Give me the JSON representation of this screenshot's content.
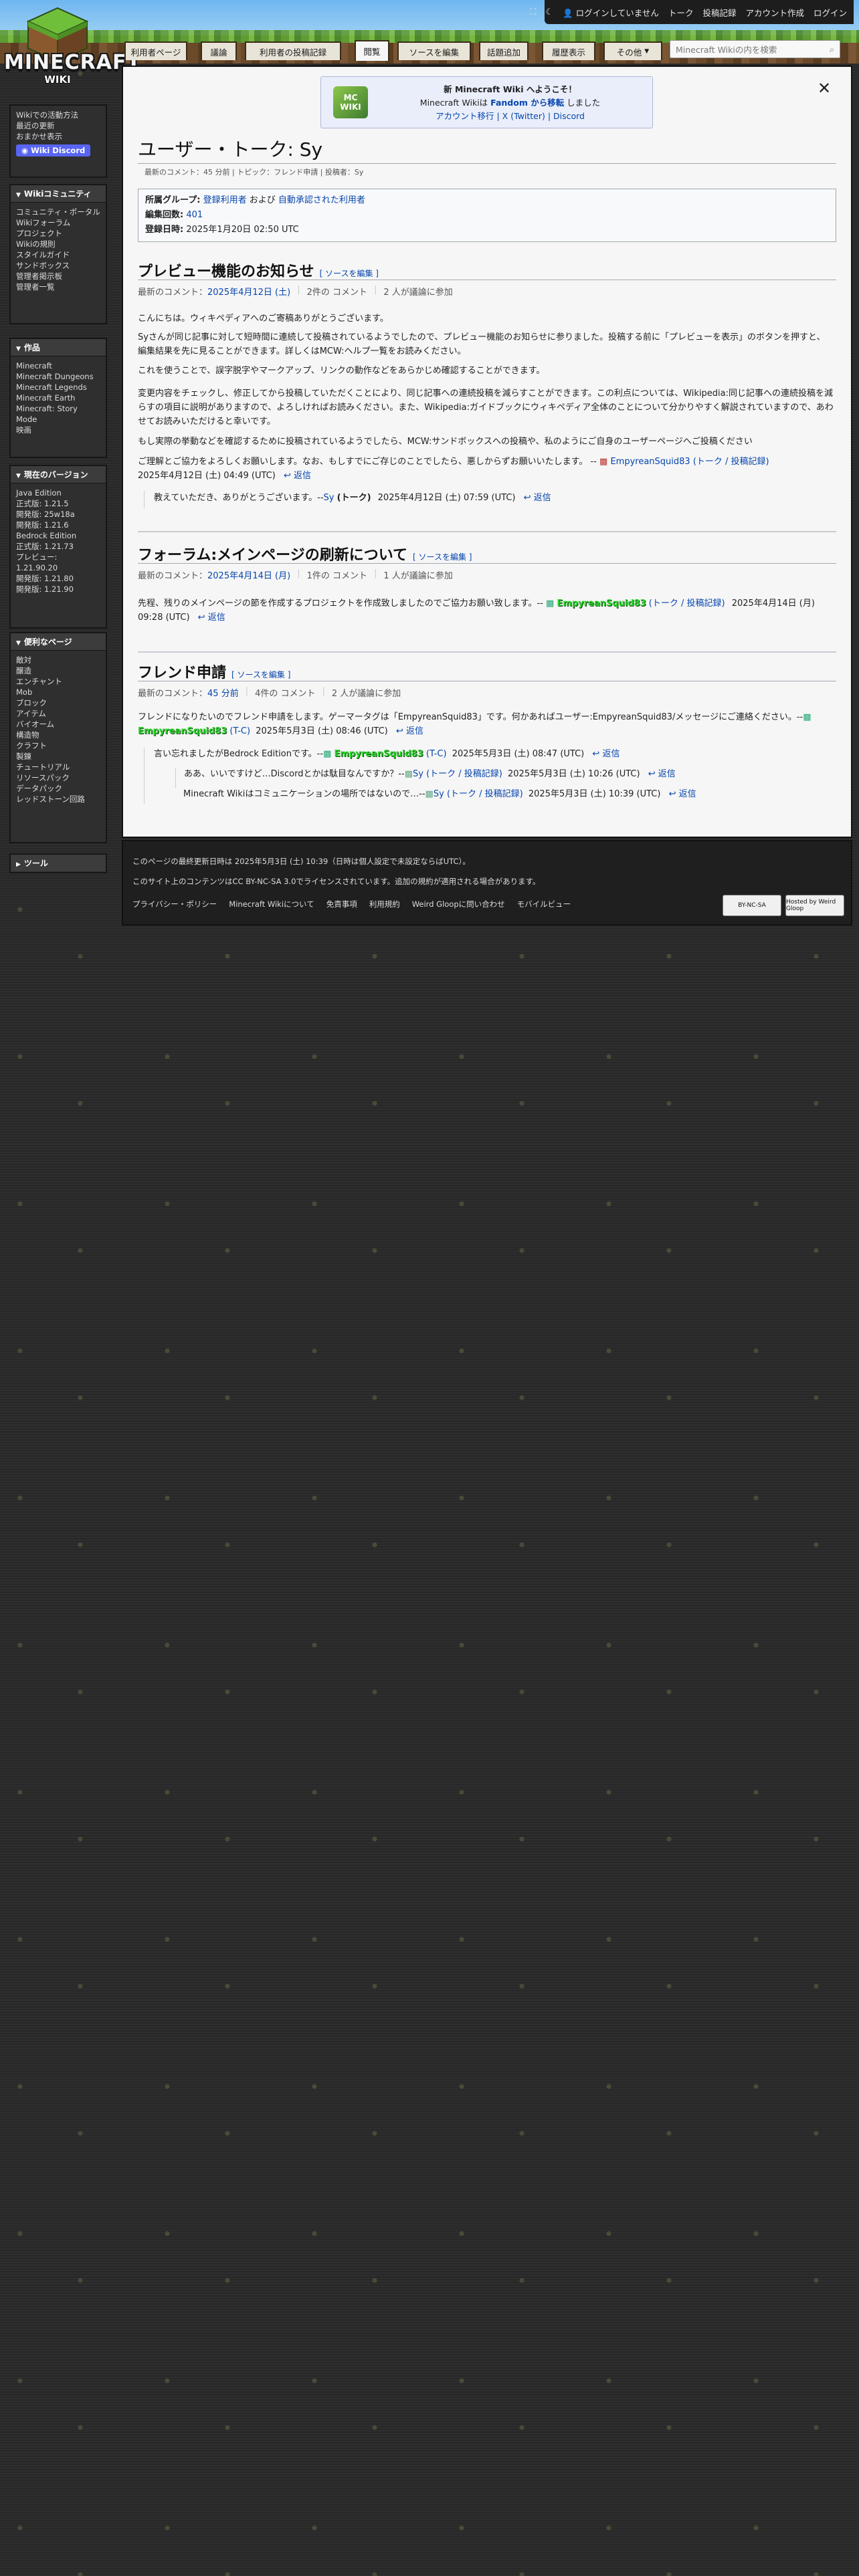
{
  "header": {
    "logo_text": "MINECRAFT",
    "logo_sub": "WIKI",
    "personal": {
      "not_logged": "ログインしていません",
      "talk": "トーク",
      "contribs": "投稿記録",
      "create_account": "アカウント作成",
      "login": "ログイン"
    },
    "tabs": [
      "利用者ページ",
      "議論",
      "利用者の投稿記録",
      "閲覧",
      "ソースを編集",
      "話題追加",
      "履歴表示",
      "その他"
    ],
    "search_placeholder": "Minecraft Wikiの内を検索"
  },
  "sidebar": {
    "top_links": [
      "Wikiでの活動方法",
      "最近の更新",
      "おまかせ表示"
    ],
    "discord_label": "Wiki Discord",
    "sections": [
      {
        "title": "Wikiコミュニティ",
        "items": [
          "コミュニティ・ポータル",
          "Wikiフォーラム",
          "プロジェクト",
          "Wikiの規則",
          "スタイルガイド",
          "サンドボックス",
          "管理者掲示板",
          "管理者一覧"
        ]
      },
      {
        "title": "作品",
        "items": [
          "Minecraft",
          "Minecraft Dungeons",
          "Minecraft Legends",
          "Minecraft Earth",
          "Minecraft: Story Mode",
          "映画"
        ]
      },
      {
        "title": "現在のバージョン",
        "items": [
          "Java Edition",
          "正式版: 1.21.5",
          "開発版: 25w18a",
          "開発版: 1.21.6",
          "Bedrock Edition",
          "正式版: 1.21.73",
          "プレビュー: 1.21.90.20",
          "開発版: 1.21.80",
          "開発版: 1.21.90"
        ]
      },
      {
        "title": "便利なページ",
        "items": [
          "敵対",
          "醸造",
          "エンチャント",
          "Mob",
          "ブロック",
          "アイテム",
          "バイオーム",
          "構造物",
          "クラフト",
          "製錬",
          "チュートリアル",
          "リソースパック",
          "データパック",
          "レッドストーン回路"
        ]
      },
      {
        "title": "ツール",
        "items": []
      }
    ]
  },
  "notice": {
    "line1_a": "新 ",
    "line1_b": "Minecraft Wiki",
    "line1_c": " へようこそ！",
    "line2_a": "Minecraft Wikiは ",
    "line2_b": "Fandom から移転",
    "line2_c": " しました",
    "line3": "アカウント移行 | X (Twitter) | Discord",
    "img_label": "MC WIKI"
  },
  "page": {
    "title": "ユーザー・トーク: Sy",
    "meta": "最新のコメント：45 分前 | トピック：フレンド申請 | 投稿者：Sy",
    "infobox": {
      "groups_label": "所属グループ:",
      "groups_a": "登録利用者",
      "groups_and": " および ",
      "groups_b": "自動承認された利用者",
      "edits_label": "編集回数:",
      "edits": "401",
      "registered_label": "登録日時:",
      "registered": "2025年1月20日 02:50 UTC"
    }
  },
  "threads": [
    {
      "title": "プレビュー機能のお知らせ",
      "edit": "[ ソースを編集 ]",
      "last": "最新のコメント：",
      "last_link": "2025年4月12日 (土)",
      "count": "2件の コメント",
      "people": "2 人が議論に参加",
      "p1": "こんにちは。ウィキペディアへのご寄稿ありがとうございます。",
      "p2": "Syさんが同じ記事に対して短時間に連続して投稿されているようでしたので、プレビュー機能のお知らせに参りました。投稿する前に「プレビューを表示」のボタンを押すと、編集結果を先に見ることができます。詳しくはMCW:ヘルプ一覧をお読みください。",
      "p3": "これを使うことで、誤字脱字やマークアップ、リンクの動作などをあらかじめ確認することができます。",
      "p4": "変更内容をチェックし、修正してから投稿していただくことにより、同じ記事への連続投稿を減らすことができます。この利点については、Wikipedia:同じ記事への連続投稿を減らすの項目に説明がありますので、よろしければお読みください。また、Wikipedia:ガイドブックにウィキペディア全体のことについて分かりやすく解説されていますので、あわせてお読みいただけると幸いです。",
      "p5": "もし実際の挙動などを確認するために投稿されているようでしたら、MCW:サンドボックスへの投稿や、私のようにご自身のユーザーページへご投稿ください",
      "p6a": "ご理解とご協力をよろしくお願いします。なお、もしすでにご存じのことでしたら、悪しからずお願いいたします。 -- ",
      "p6_user": "EmpyreanSquid83",
      "p6_talk": "(トーク / 投稿記録)",
      "p6_date": "2025年4月12日 (土) 04:49 (UTC)",
      "reply": "返信",
      "r1_text": "教えていただき、ありがとうございます。--",
      "r1_user": "Sy",
      "r1_talk": "(トーク)",
      "r1_date": "2025年4月12日 (土) 07:59 (UTC)"
    },
    {
      "title": "フォーラム:メインページの刷新について",
      "edit": "[ ソースを編集 ]",
      "last": "最新のコメント：",
      "last_link": "2025年4月14日 (月)",
      "count": "1件の コメント",
      "people": "1 人が議論に参加",
      "p1": "先程、残りのメインページの節を作成するプロジェクトを作成致しましたのでご協力お願い致します。-- ",
      "user": "EmpyreanSquid83",
      "talk": "(トーク / 投稿記録)",
      "date": "2025年4月14日 (月) 09:28 (UTC)",
      "reply": "返信"
    },
    {
      "title": "フレンド申請",
      "edit": "[ ソースを編集 ]",
      "last": "最新のコメント：",
      "last_link": "45 分前",
      "count": "4件の コメント",
      "people": "2 人が議論に参加",
      "p1": "フレンドになりたいのでフレンド申請をします。ゲーマータグは「EmpyreanSquid83」です。何かあればユーザー:EmpyreanSquid83/メッセージにご連絡ください。--",
      "user": "EmpyreanSquid83",
      "tc": "(T-C)",
      "date": "2025年5月3日 (土) 08:46 (UTC)",
      "reply": "返信",
      "r1": "言い忘れましたがBedrock Editionです。--",
      "r1_date": "2025年5月3日 (土) 08:47 (UTC)",
      "r2": "ああ、いいですけど…Discordとかは駄目なんですか？--",
      "r2_user": "Sy",
      "r2_talk": "(トーク / 投稿記録)",
      "r2_date": "2025年5月3日 (土) 10:26 (UTC)",
      "r3": "Minecraft Wikiはコミュニケーションの場所ではないので…--",
      "r3_date": "2025年5月3日 (土) 10:39 (UTC)"
    }
  ],
  "footer": {
    "l1": "このページの最終更新日時は 2025年5月3日 (土) 10:39（日時は個人設定で未設定ならばUTC）。",
    "l2": "このサイト上のコンテンツはCC BY-NC-SA 3.0でライセンスされています。追加の規約が適用される場合があります。",
    "links": [
      "プライバシー・ポリシー",
      "Minecraft Wikiについて",
      "免責事項",
      "利用規約",
      "Weird Gloopに問い合わせ",
      "モバイルビュー"
    ],
    "badge1": "BY-NC-SA",
    "badge2": "Hosted by Weird Gloop"
  }
}
